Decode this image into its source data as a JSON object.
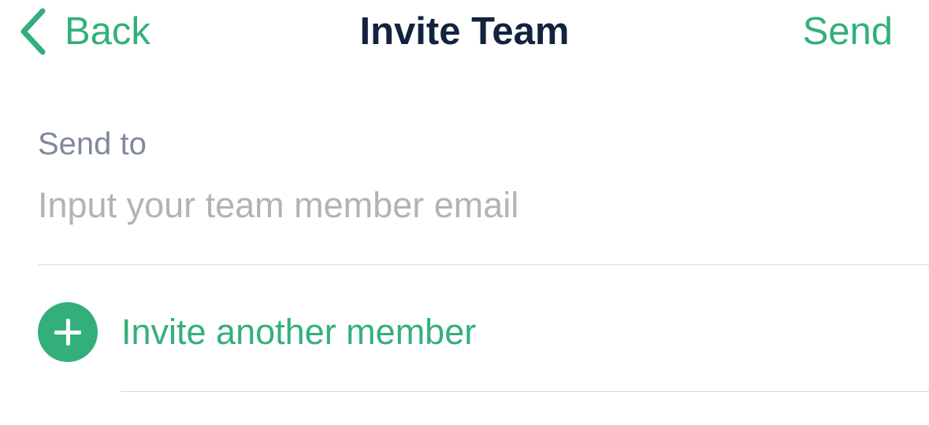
{
  "nav": {
    "back_label": "Back",
    "back_icon": "chevron-left-icon",
    "title": "Invite Team",
    "send_label": "Send"
  },
  "form": {
    "label": "Send to",
    "email_value": "",
    "email_placeholder": "Input your team member email"
  },
  "invite": {
    "icon": "plus-circle-icon",
    "label": "Invite another member"
  },
  "colors": {
    "accent": "#33b07a",
    "title": "#13233f",
    "label": "#7f8a9a",
    "placeholder": "#b3b3b3",
    "divider": "#d6d6d6"
  }
}
